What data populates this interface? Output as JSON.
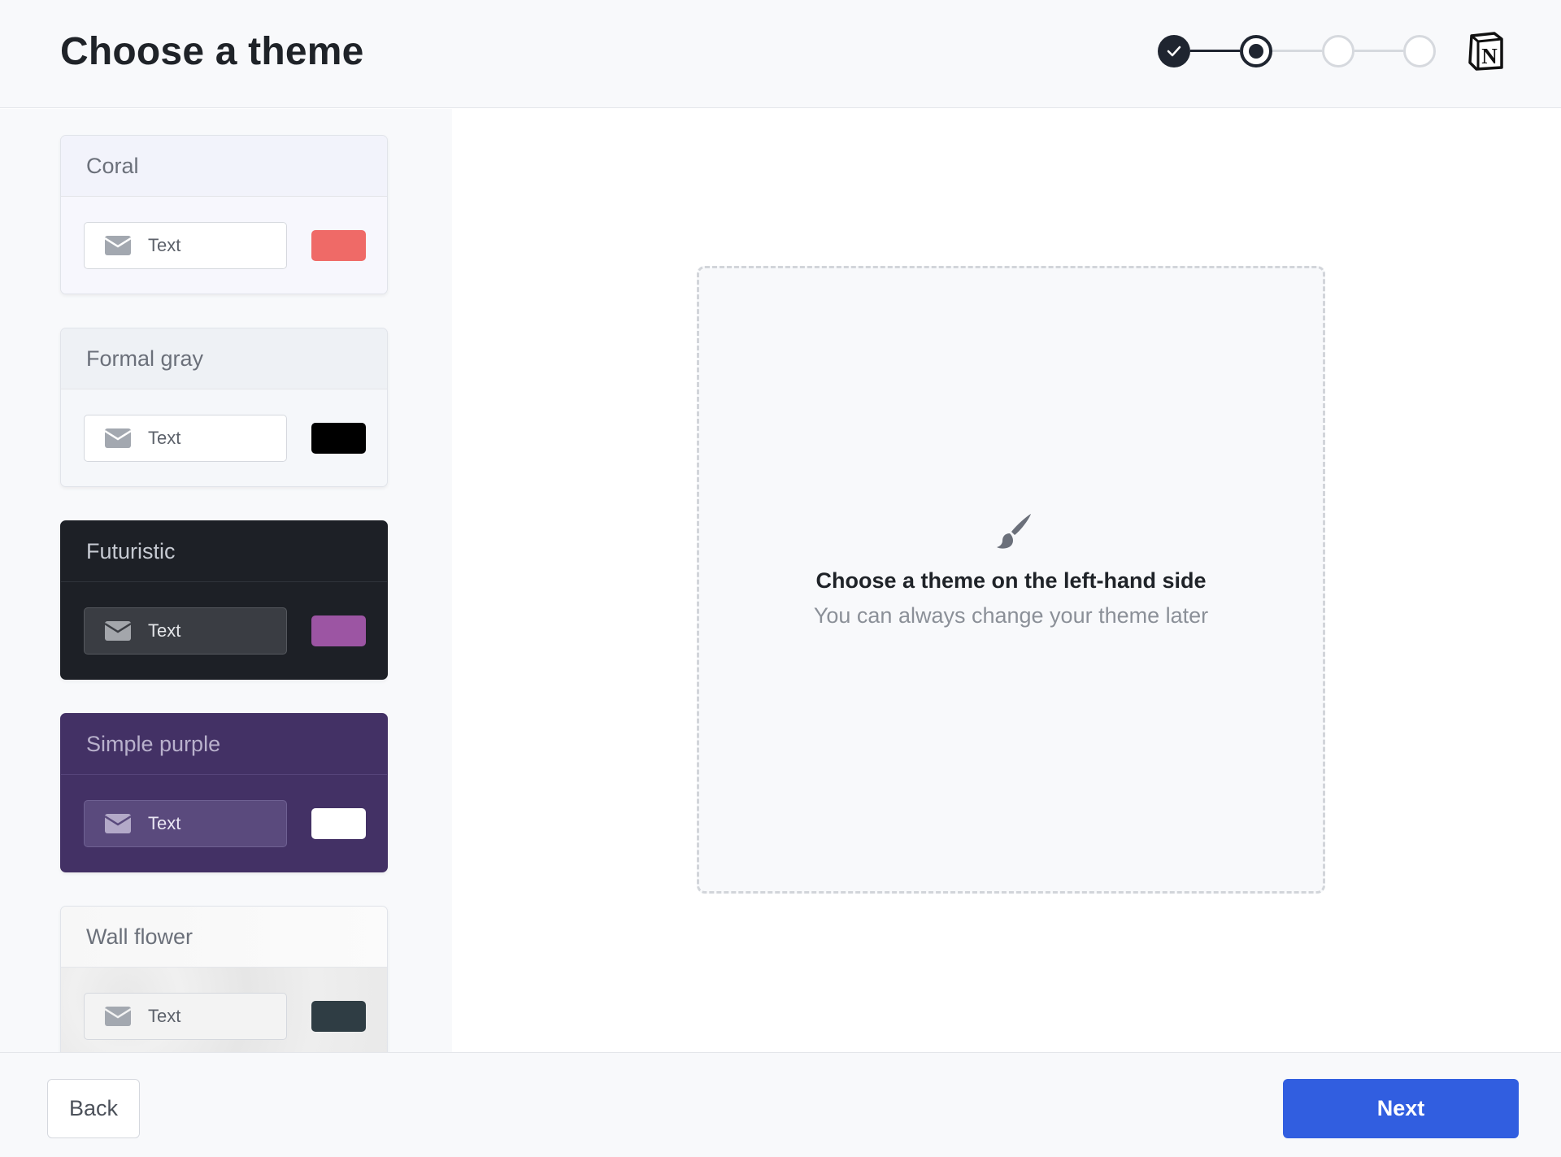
{
  "header": {
    "title": "Choose a theme",
    "steps": [
      "completed",
      "current",
      "upcoming",
      "upcoming"
    ]
  },
  "themes": [
    {
      "name": "Coral",
      "input_text": "Text",
      "swatch_color": "#ef6a67"
    },
    {
      "name": "Formal gray",
      "input_text": "Text",
      "swatch_color": "#000000"
    },
    {
      "name": "Futuristic",
      "input_text": "Text",
      "swatch_color": "#9c55a3"
    },
    {
      "name": "Simple purple",
      "input_text": "Text",
      "swatch_color": "#ffffff"
    },
    {
      "name": "Wall flower",
      "input_text": "Text",
      "swatch_color": "#2f3d44"
    }
  ],
  "preview": {
    "icon": "paintbrush-icon",
    "title": "Choose a theme on the left-hand side",
    "subtitle": "You can always change your theme later"
  },
  "footer": {
    "back_label": "Back",
    "next_label": "Next"
  },
  "colors": {
    "accent": "#315ee0",
    "dark": "#1f2530"
  }
}
